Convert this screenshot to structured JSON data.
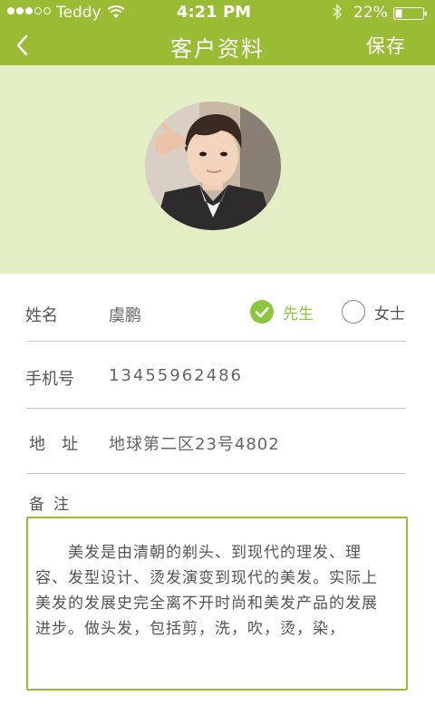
{
  "status_bar": {
    "carrier": "Teddy",
    "time": "4:21 PM",
    "battery_percent": "22%",
    "signal_bars_filled": 3,
    "signal_bars_total": 5
  },
  "nav": {
    "title": "客户资料",
    "save_label": "保存",
    "back_icon": "chevron-left-icon"
  },
  "colors": {
    "header": "#9abb34",
    "avatar_band": "#e4eec5",
    "accent_check": "#8cc63f",
    "selected_text": "#8cc63f"
  },
  "form": {
    "name_label": "姓名",
    "name_value": "虞鹏",
    "gender": {
      "male_label": "先生",
      "female_label": "女士",
      "selected": "male"
    },
    "phone_label": "手机号",
    "phone_value": "13455962486",
    "address_label": "地　址",
    "address_value": "地球第二区23号4802",
    "notes_label": "备注",
    "notes_value": "美发是由清朝的剃头、到现代的理发、理容、发型设计、烫发演变到现代的美发。实际上美发的发展史完全离不开时尚和美发产品的发展进步。做头发，包括剪，洗，吹，烫，染，"
  }
}
